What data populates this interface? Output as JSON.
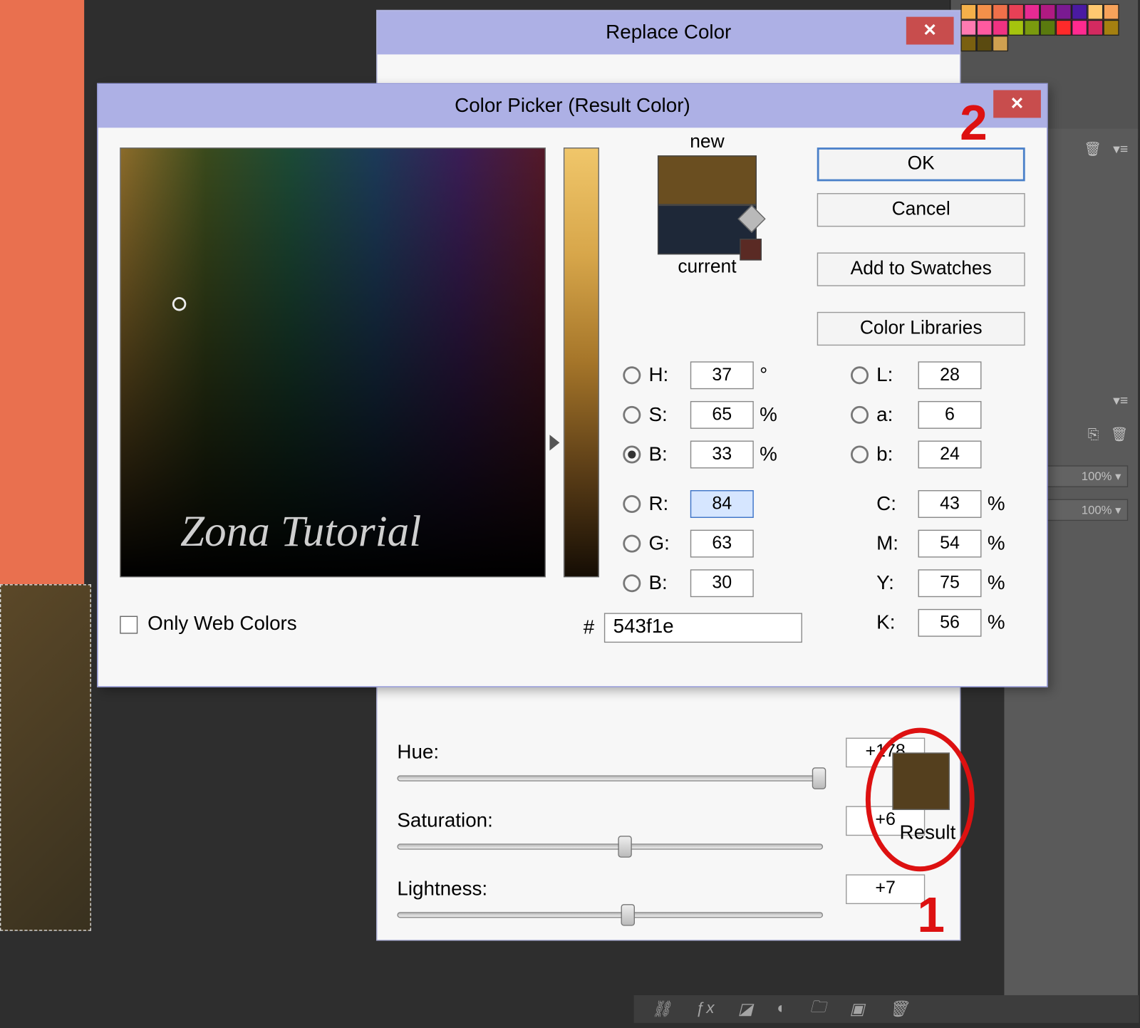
{
  "replace": {
    "title": "Replace Color",
    "hue_label": "Hue:",
    "hue_val": "+178",
    "sat_label": "Saturation:",
    "sat_val": "+6",
    "light_label": "Lightness:",
    "light_val": "+7",
    "result_label": "Result",
    "result_color": "#543f1e"
  },
  "picker": {
    "title": "Color Picker (Result Color)",
    "new_label": "new",
    "current_label": "current",
    "ok": "OK",
    "cancel": "Cancel",
    "add_swatches": "Add to Swatches",
    "color_libs": "Color Libraries",
    "only_web": "Only Web Colors",
    "watermark": "Zona Tutorial",
    "hsb": {
      "H": "37",
      "H_unit": "°",
      "S": "65",
      "S_unit": "%",
      "B": "33",
      "B_unit": "%"
    },
    "rgb": {
      "R": "84",
      "G": "63",
      "B": "30"
    },
    "lab": {
      "L": "28",
      "a": "6",
      "b": "24"
    },
    "cmyk": {
      "C": "43",
      "M": "54",
      "Y": "75",
      "K": "56",
      "unit": "%"
    },
    "hex_label": "#",
    "hex": "543f1e",
    "new_color": "#6a4e20",
    "current_color": "#1e2838"
  },
  "annot": {
    "num1": "1",
    "num2": "2"
  }
}
